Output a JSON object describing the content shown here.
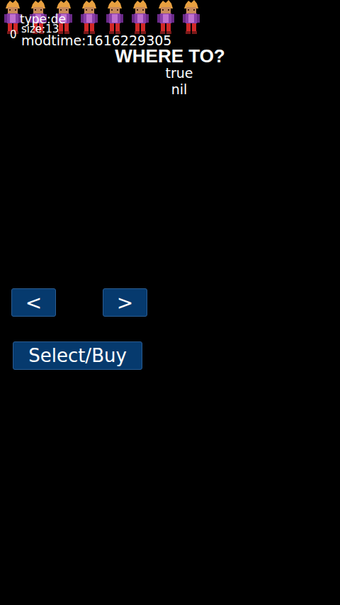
{
  "debug": {
    "lines": [
      "type:de",
      "size:13",
      "0",
      "modtime:1616229305"
    ]
  },
  "title": "WHERE TO?",
  "values": [
    "true",
    "nil"
  ],
  "characters": [
    {},
    {},
    {},
    {},
    {},
    {},
    {},
    {}
  ],
  "nav_buttons": [
    "<",
    ">"
  ],
  "select_button": "Select/Buy"
}
